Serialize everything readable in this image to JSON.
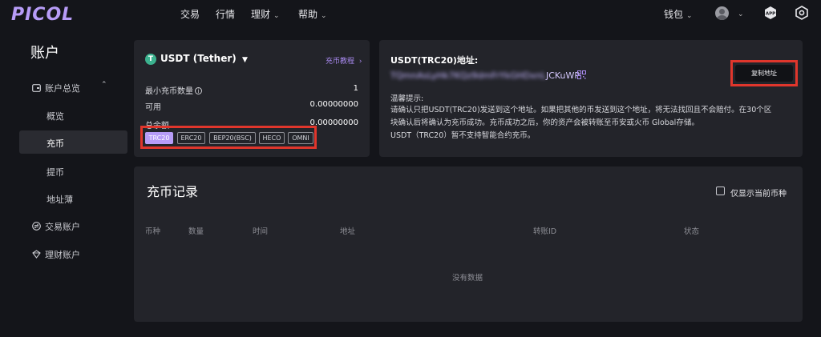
{
  "header": {
    "logo": "PICOL",
    "nav": [
      {
        "label": "交易",
        "dropdown": false
      },
      {
        "label": "行情",
        "dropdown": false
      },
      {
        "label": "理财",
        "dropdown": true
      },
      {
        "label": "帮助",
        "dropdown": true
      }
    ],
    "wallet_label": "钱包",
    "app_icon_text": "APP"
  },
  "sidebar": {
    "title": "账户",
    "items": [
      {
        "label": "账户总览",
        "icon": "wallet-icon",
        "expanded": true
      },
      {
        "label": "概览"
      },
      {
        "label": "充币",
        "active": true
      },
      {
        "label": "提币"
      },
      {
        "label": "地址薄"
      },
      {
        "label": "交易账户",
        "icon": "exchange-icon"
      },
      {
        "label": "理财账户",
        "icon": "finance-icon"
      }
    ]
  },
  "deposit": {
    "coin_symbol_icon": "T",
    "coin_name": "USDT (Tether)",
    "tutorial_link": "充币教程",
    "min_label": "最小充币数量",
    "min_value": "1",
    "available_label": "可用",
    "available_value": "0.00000000",
    "total_label": "总余额",
    "total_value": "0.00000000",
    "chains": [
      "TRC20",
      "ERC20",
      "BEP20(BSC)",
      "HECO",
      "OMNI"
    ],
    "selected_chain": "TRC20"
  },
  "address": {
    "title": "USDT(TRC20)地址:",
    "value_masked": "TQmnAsLyHk7KQz9dmFrYkGHDxnL",
    "value_visible": "JCKuWP",
    "copy_button": "复制地址",
    "tip_title": "温馨提示:",
    "tip_lines": [
      "请确认只把USDT(TRC20)发送到这个地址。如果把其他的币发送到这个地址，将无法找回且不会赔付。在30个区",
      "块确认后将确认为充币成功。充币成功之后，你的资产会被转账至币安或火币 Global存储。",
      "USDT（TRC20）暂不支持智能合约充币。"
    ]
  },
  "records": {
    "title": "充币记录",
    "filter_label": "仅显示当前币种",
    "filter_checked": false,
    "columns": [
      "币种",
      "数量",
      "时间",
      "地址",
      "转账ID",
      "状态"
    ],
    "empty_text": "没有数据"
  },
  "colors": {
    "accent": "#b79cf7",
    "highlight_box": "#e0362c",
    "background": "#14151a",
    "card": "#23242a"
  }
}
